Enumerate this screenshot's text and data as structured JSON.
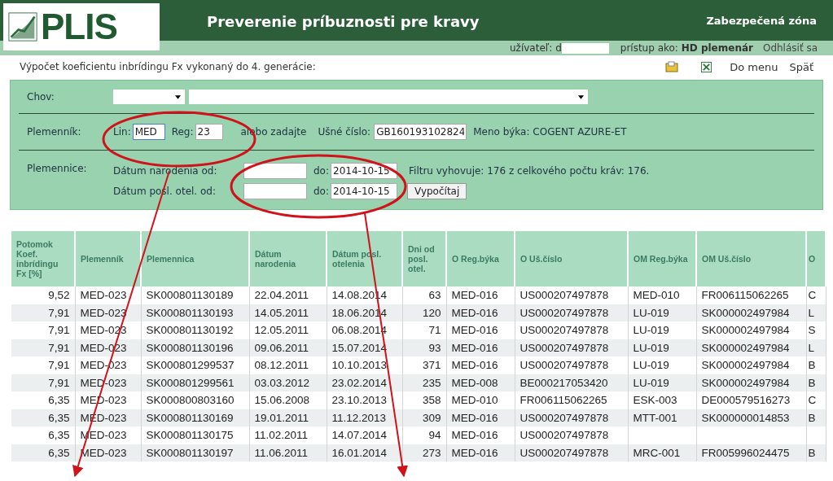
{
  "header": {
    "logo": "PLIS",
    "title": "Preverenie príbuznosti pre kravy",
    "zone": "Zabezpečená zóna"
  },
  "user_bar": {
    "user_label": "užívateľ: d",
    "access_label": "prístup ako:",
    "access_role": "HD plemenár",
    "logout": "Odhlásiť sa"
  },
  "toolbar": {
    "title": "Výpočet koeficientu inbrídingu Fx vykonaný do 4. generácie:",
    "links": [
      "Do menu",
      "Späť"
    ]
  },
  "filter": {
    "chov_label": "Chov:",
    "plemennik": {
      "label": "Plemenník:",
      "lin_label": "Lin:",
      "lin_value": "MED",
      "reg_label": "Reg:",
      "reg_value": "23",
      "or_text": "alebo zadajte",
      "ear_label": "Ušné číslo:",
      "ear_value": "GB160193102824",
      "bull_name": "Meno býka: COGENT AZURE-ET"
    },
    "plemennice": {
      "label": "Plemennice:",
      "rows": [
        {
          "label": "Dátum narodenia od:",
          "to_label": "do:",
          "to_value": "2014-10-15"
        },
        {
          "label": "Dátum posl. otel. od:",
          "to_label": "do:",
          "to_value": "2014-10-15"
        }
      ],
      "result": "Filtru vyhovuje: 176 z celkového počtu kráv: 176.",
      "button": "Vypočítaj"
    }
  },
  "table": {
    "columns": [
      "Potomok Koef. inbrídingu Fx [%]",
      "Plemenník",
      "Plemennica",
      "Dátum narodenia",
      "Dátum posl. otelenia",
      "Dni od posl. otel.",
      "O Reg.býka",
      "O Uš.číslo",
      "OM Reg.býka",
      "OM Uš.číslo",
      "O"
    ],
    "rows": [
      [
        "9,52",
        "MED-023",
        "SK000801130189",
        "22.04.2011",
        "14.08.2014",
        "63",
        "MED-016",
        "US000207497878",
        "MED-010",
        "FR006115062265",
        "C"
      ],
      [
        "7,91",
        "MED-023",
        "SK000801130193",
        "14.05.2011",
        "18.06.2014",
        "120",
        "MED-016",
        "US000207497878",
        "LU-019",
        "SK000002497984",
        "L"
      ],
      [
        "7,91",
        "MED-023",
        "SK000801130192",
        "12.05.2011",
        "06.08.2014",
        "71",
        "MED-016",
        "US000207497878",
        "LU-019",
        "SK000002497984",
        "S"
      ],
      [
        "7,91",
        "MED-023",
        "SK000801130196",
        "09.06.2011",
        "15.07.2014",
        "93",
        "MED-016",
        "US000207497878",
        "LU-019",
        "SK000002497984",
        "L"
      ],
      [
        "7,91",
        "MED-023",
        "SK000801299537",
        "08.12.2011",
        "10.10.2013",
        "371",
        "MED-016",
        "US000207497878",
        "LU-019",
        "SK000002497984",
        "B"
      ],
      [
        "7,91",
        "MED-023",
        "SK000801299561",
        "03.03.2012",
        "23.02.2014",
        "235",
        "MED-008",
        "BE000217053420",
        "LU-019",
        "SK000002497984",
        "B"
      ],
      [
        "6,35",
        "MED-023",
        "SK000800803160",
        "15.06.2008",
        "23.10.2013",
        "358",
        "MED-010",
        "FR006115062265",
        "ESK-003",
        "DE000579516273",
        "C"
      ],
      [
        "6,35",
        "MED-023",
        "SK000801130169",
        "19.01.2011",
        "11.12.2013",
        "309",
        "MED-016",
        "US000207497878",
        "MTT-001",
        "SK000000014853",
        "B"
      ],
      [
        "6,35",
        "MED-023",
        "SK000801130175",
        "11.02.2011",
        "14.07.2014",
        "94",
        "MED-016",
        "US000207497878",
        "",
        "",
        ""
      ],
      [
        "6,35",
        "MED-023",
        "SK000801130197",
        "11.06.2011",
        "16.01.2014",
        "273",
        "MED-016",
        "US000207497878",
        "MRC-001",
        "FR005996024475",
        "B"
      ]
    ]
  }
}
